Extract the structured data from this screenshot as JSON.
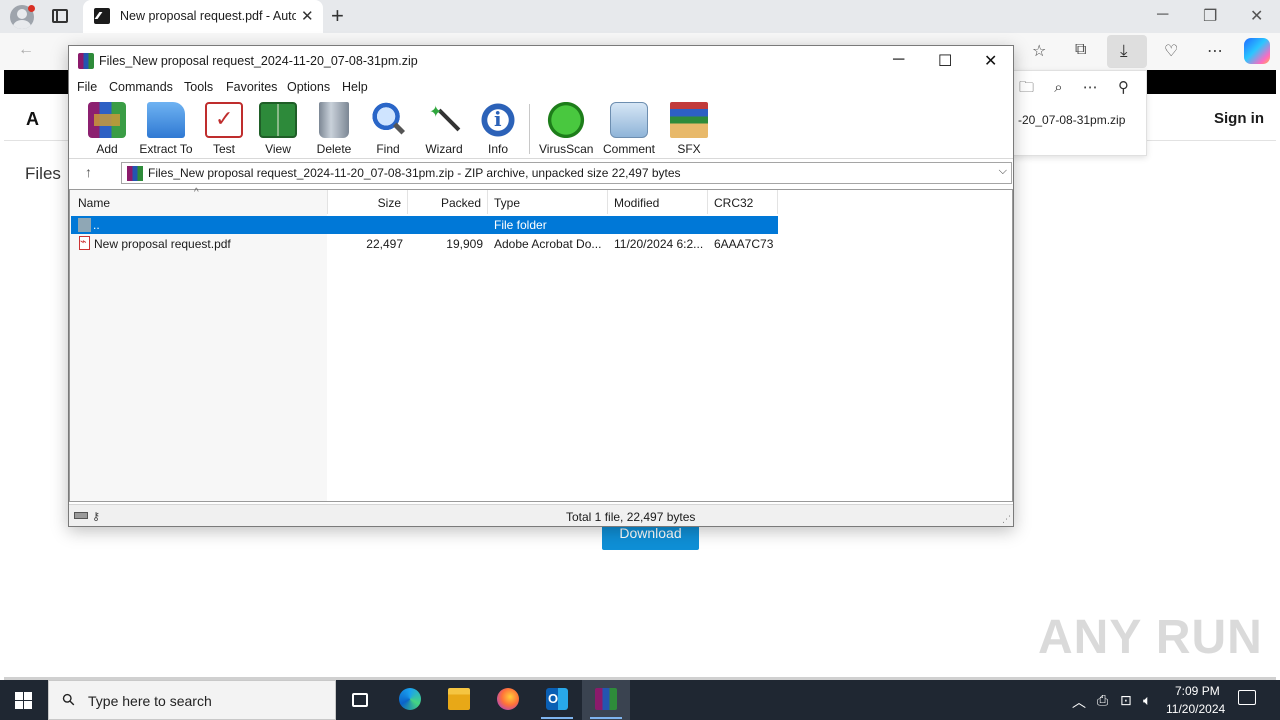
{
  "browser": {
    "tab_title": "New proposal request.pdf - Auto",
    "tab_close": "✕",
    "new_tab": "+",
    "win_min": "─",
    "win_restore": "❐",
    "win_close": "✕",
    "nav_back": "←",
    "toolbar_icons": [
      "favorites-icon",
      "collections-icon",
      "download-icon",
      "performance-icon",
      "more-icon",
      "copilot-icon"
    ],
    "download_flyout_filename": "-20_07-08-31pm.zip"
  },
  "page": {
    "signin": "Sign in",
    "files_label": "Files",
    "download_button": "Download",
    "logo": "A",
    "watermark": "ANY RUN"
  },
  "winrar": {
    "title": "Files_New proposal request_2024-11-20_07-08-31pm.zip",
    "menu": [
      "File",
      "Commands",
      "Tools",
      "Favorites",
      "Options",
      "Help"
    ],
    "tools": [
      "Add",
      "Extract To",
      "Test",
      "View",
      "Delete",
      "Find",
      "Wizard",
      "Info",
      "VirusScan",
      "Comment",
      "SFX"
    ],
    "address": "Files_New proposal request_2024-11-20_07-08-31pm.zip - ZIP archive, unpacked size 22,497 bytes",
    "columns": [
      "Name",
      "Size",
      "Packed",
      "Type",
      "Modified",
      "CRC32"
    ],
    "rows": [
      {
        "name": "..",
        "size": "",
        "packed": "",
        "type": "File folder",
        "modified": "",
        "crc": ""
      },
      {
        "name": "New proposal request.pdf",
        "size": "22,497",
        "packed": "19,909",
        "type": "Adobe Acrobat Do...",
        "modified": "11/20/2024 6:2...",
        "crc": "6AAA7C73"
      }
    ],
    "status": "Total 1 file, 22,497 bytes"
  },
  "taskbar": {
    "search_placeholder": "Type here to search",
    "time": "7:09 PM",
    "date": "11/20/2024",
    "apps": [
      "task-view",
      "edge",
      "file-explorer",
      "firefox",
      "outlook",
      "winrar"
    ]
  },
  "colors": {
    "selection": "#0078d7",
    "taskbar": "#1f2732",
    "page_download": "#0f8fd6"
  }
}
